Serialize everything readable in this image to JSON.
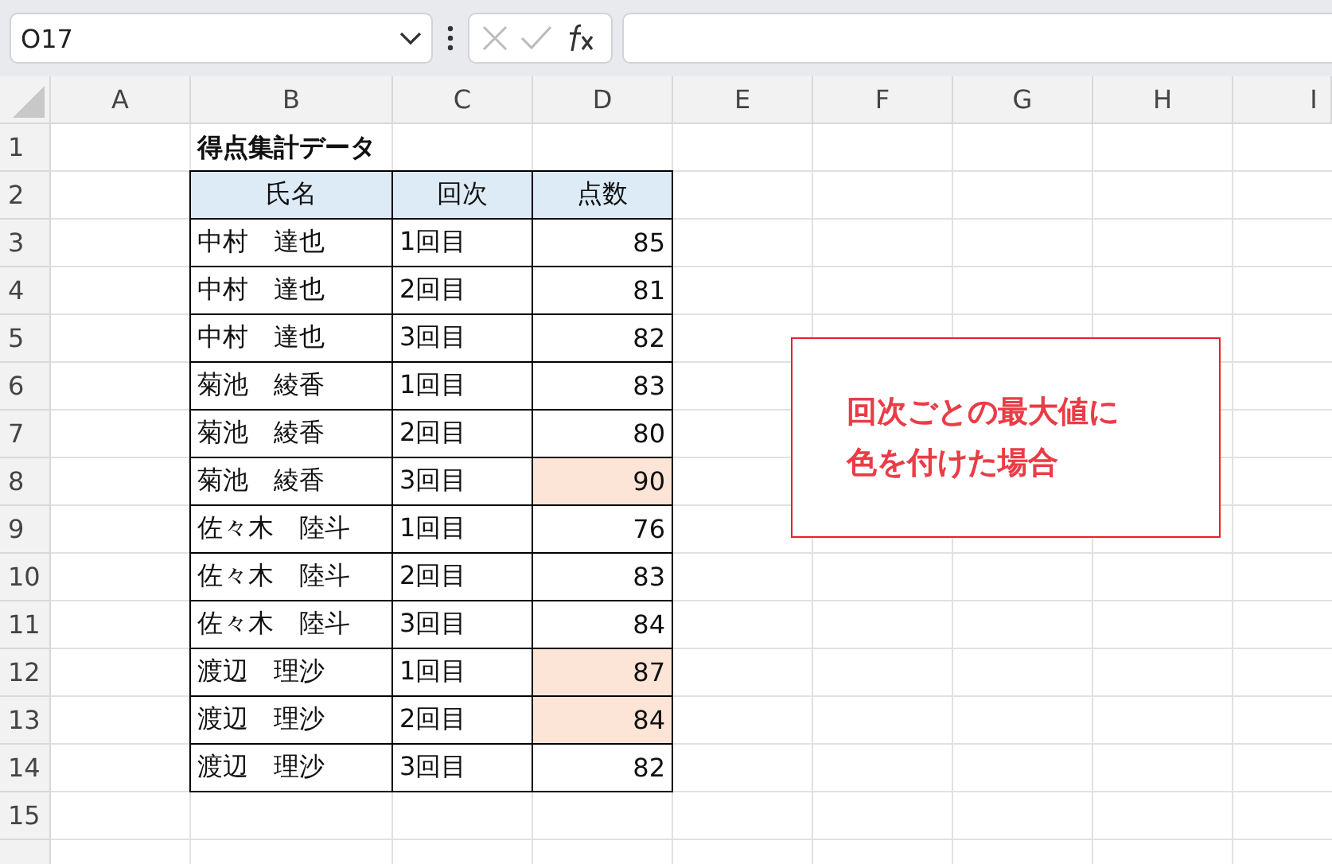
{
  "name_box": {
    "value": "O17"
  },
  "sheet": {
    "columns": [
      "A",
      "B",
      "C",
      "D",
      "E",
      "F",
      "G",
      "H",
      "I"
    ],
    "row_numbers": [
      "1",
      "2",
      "3",
      "4",
      "5",
      "6",
      "7",
      "8",
      "9",
      "10",
      "11",
      "12",
      "13",
      "14",
      "15"
    ]
  },
  "title": "得点集計データ",
  "table": {
    "columns": [
      "氏名",
      "回次",
      "点数"
    ],
    "rows": [
      {
        "name": "中村　達也",
        "round": "1回目",
        "score": "85",
        "highlighted": false
      },
      {
        "name": "中村　達也",
        "round": "2回目",
        "score": "81",
        "highlighted": false
      },
      {
        "name": "中村　達也",
        "round": "3回目",
        "score": "82",
        "highlighted": false
      },
      {
        "name": "菊池　綾香",
        "round": "1回目",
        "score": "83",
        "highlighted": false
      },
      {
        "name": "菊池　綾香",
        "round": "2回目",
        "score": "80",
        "highlighted": false
      },
      {
        "name": "菊池　綾香",
        "round": "3回目",
        "score": "90",
        "highlighted": true
      },
      {
        "name": "佐々木　陸斗",
        "round": "1回目",
        "score": "76",
        "highlighted": false
      },
      {
        "name": "佐々木　陸斗",
        "round": "2回目",
        "score": "83",
        "highlighted": false
      },
      {
        "name": "佐々木　陸斗",
        "round": "3回目",
        "score": "84",
        "highlighted": false
      },
      {
        "name": "渡辺　理沙",
        "round": "1回目",
        "score": "87",
        "highlighted": true
      },
      {
        "name": "渡辺　理沙",
        "round": "2回目",
        "score": "84",
        "highlighted": true
      },
      {
        "name": "渡辺　理沙",
        "round": "3回目",
        "score": "82",
        "highlighted": false
      }
    ]
  },
  "text_box": {
    "lines": [
      "回次ごとの最大値に",
      "色を付けた場合"
    ]
  }
}
